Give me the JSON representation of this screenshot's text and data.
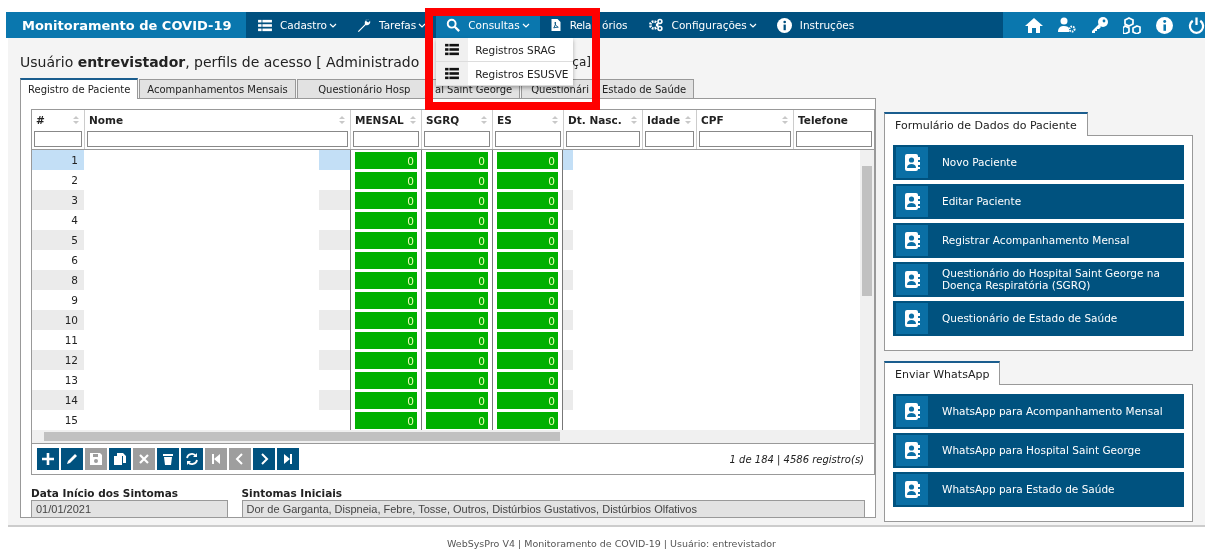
{
  "header": {
    "title": "Monitoramento de COVID-19",
    "menu": [
      {
        "label": "Cadastro",
        "has_submenu": true,
        "open": false
      },
      {
        "label": "Tarefas",
        "has_submenu": true,
        "open": false
      },
      {
        "label": "Consultas",
        "has_submenu": true,
        "open": true,
        "submenu": [
          "Registros SRAG",
          "Registros ESUSVE"
        ]
      },
      {
        "label": "Rela",
        "label_rest": "órios",
        "has_submenu": false,
        "open": false
      },
      {
        "label": "Configurações",
        "has_submenu": true,
        "open": false
      },
      {
        "label": "Instruções",
        "has_submenu": false,
        "open": false
      }
    ]
  },
  "heading": {
    "text": "Usuário **entrevistador**, perfils de acesso [ Administrado",
    "tail": "ça]"
  },
  "tabs": [
    {
      "label": "Registro de Paciente",
      "selected": true
    },
    {
      "label": "Acompanhamentos Mensais",
      "selected": false
    },
    {
      "label": "Questionário Hosp",
      "label_rest": "al Saint George",
      "selected": false
    },
    {
      "label": "Questionári",
      "label_rest": "Estado de Saúde",
      "selected": false
    }
  ],
  "grid": {
    "columns": [
      {
        "label": "#",
        "kind": "number"
      },
      {
        "label": "Nome",
        "kind": "text"
      },
      {
        "label": "MENSAL",
        "kind": "score"
      },
      {
        "label": "SGRQ",
        "kind": "score"
      },
      {
        "label": "ES",
        "kind": "score"
      },
      {
        "label": "Dt. Nasc.",
        "kind": "text"
      },
      {
        "label": "Idade",
        "kind": "text"
      },
      {
        "label": "CPF",
        "kind": "text"
      },
      {
        "label": "Telefone",
        "kind": "text"
      }
    ],
    "rows": [
      {
        "number": "1",
        "mensal": "0",
        "sgrq": "0",
        "es": "0",
        "selected": true
      },
      {
        "number": "2",
        "mensal": "0",
        "sgrq": "0",
        "es": "0",
        "selected": false
      },
      {
        "number": "3",
        "mensal": "0",
        "sgrq": "0",
        "es": "0",
        "selected": false
      },
      {
        "number": "4",
        "mensal": "0",
        "sgrq": "0",
        "es": "0",
        "selected": false
      },
      {
        "number": "5",
        "mensal": "0",
        "sgrq": "0",
        "es": "0",
        "selected": false
      },
      {
        "number": "6",
        "mensal": "0",
        "sgrq": "0",
        "es": "0",
        "selected": false
      },
      {
        "number": "8",
        "mensal": "0",
        "sgrq": "0",
        "es": "0",
        "selected": false
      },
      {
        "number": "9",
        "mensal": "0",
        "sgrq": "0",
        "es": "0",
        "selected": false
      },
      {
        "number": "10",
        "mensal": "0",
        "sgrq": "0",
        "es": "0",
        "selected": false
      },
      {
        "number": "11",
        "mensal": "0",
        "sgrq": "0",
        "es": "0",
        "selected": false
      },
      {
        "number": "12",
        "mensal": "0",
        "sgrq": "0",
        "es": "0",
        "selected": false
      },
      {
        "number": "13",
        "mensal": "0",
        "sgrq": "0",
        "es": "0",
        "selected": false
      },
      {
        "number": "14",
        "mensal": "0",
        "sgrq": "0",
        "es": "0",
        "selected": false
      },
      {
        "number": "15",
        "mensal": "0",
        "sgrq": "0",
        "es": "0",
        "selected": false
      }
    ],
    "toolbar": [
      {
        "kind": "add",
        "disabled": false
      },
      {
        "kind": "edit",
        "disabled": false
      },
      {
        "kind": "save",
        "disabled": true
      },
      {
        "kind": "copy",
        "disabled": false
      },
      {
        "kind": "cancel",
        "disabled": true
      },
      {
        "kind": "delete",
        "disabled": false
      },
      {
        "kind": "refresh",
        "disabled": false
      },
      {
        "kind": "first",
        "disabled": true
      },
      {
        "kind": "previous",
        "disabled": true
      },
      {
        "kind": "next",
        "disabled": false
      },
      {
        "kind": "last",
        "disabled": false
      }
    ],
    "pager": "1 de 184 | 4586 registro(s)"
  },
  "fields": [
    {
      "label": "Data Início dos Sintomas",
      "value": "01/01/2021"
    },
    {
      "label": "Sintomas Iniciais",
      "value": "Dor de Garganta, Dispneia, Febre, Tosse, Outros, Distúrbios Gustativos, Distúrbios Olfativos"
    }
  ],
  "panels": [
    {
      "title": "Formulário de Dados do Paciente",
      "buttons": [
        "Novo Paciente",
        "Editar Paciente",
        "Registrar Acompanhamento Mensal",
        "Questionário do Hospital Saint George na Doença Respiratória (SGRQ)",
        "Questionário de Estado de Saúde"
      ]
    },
    {
      "title": "Enviar WhatsApp",
      "buttons": [
        "WhatsApp para Acompanhamento Mensal",
        "WhatsApp para Hospital Saint George",
        "WhatsApp para Estado de Saúde"
      ]
    }
  ],
  "footer": "WebSysPro V4 | Monitoramento de COVID-19 | Usuário: entrevistador",
  "annotations": [
    {
      "kind": "frame"
    }
  ]
}
